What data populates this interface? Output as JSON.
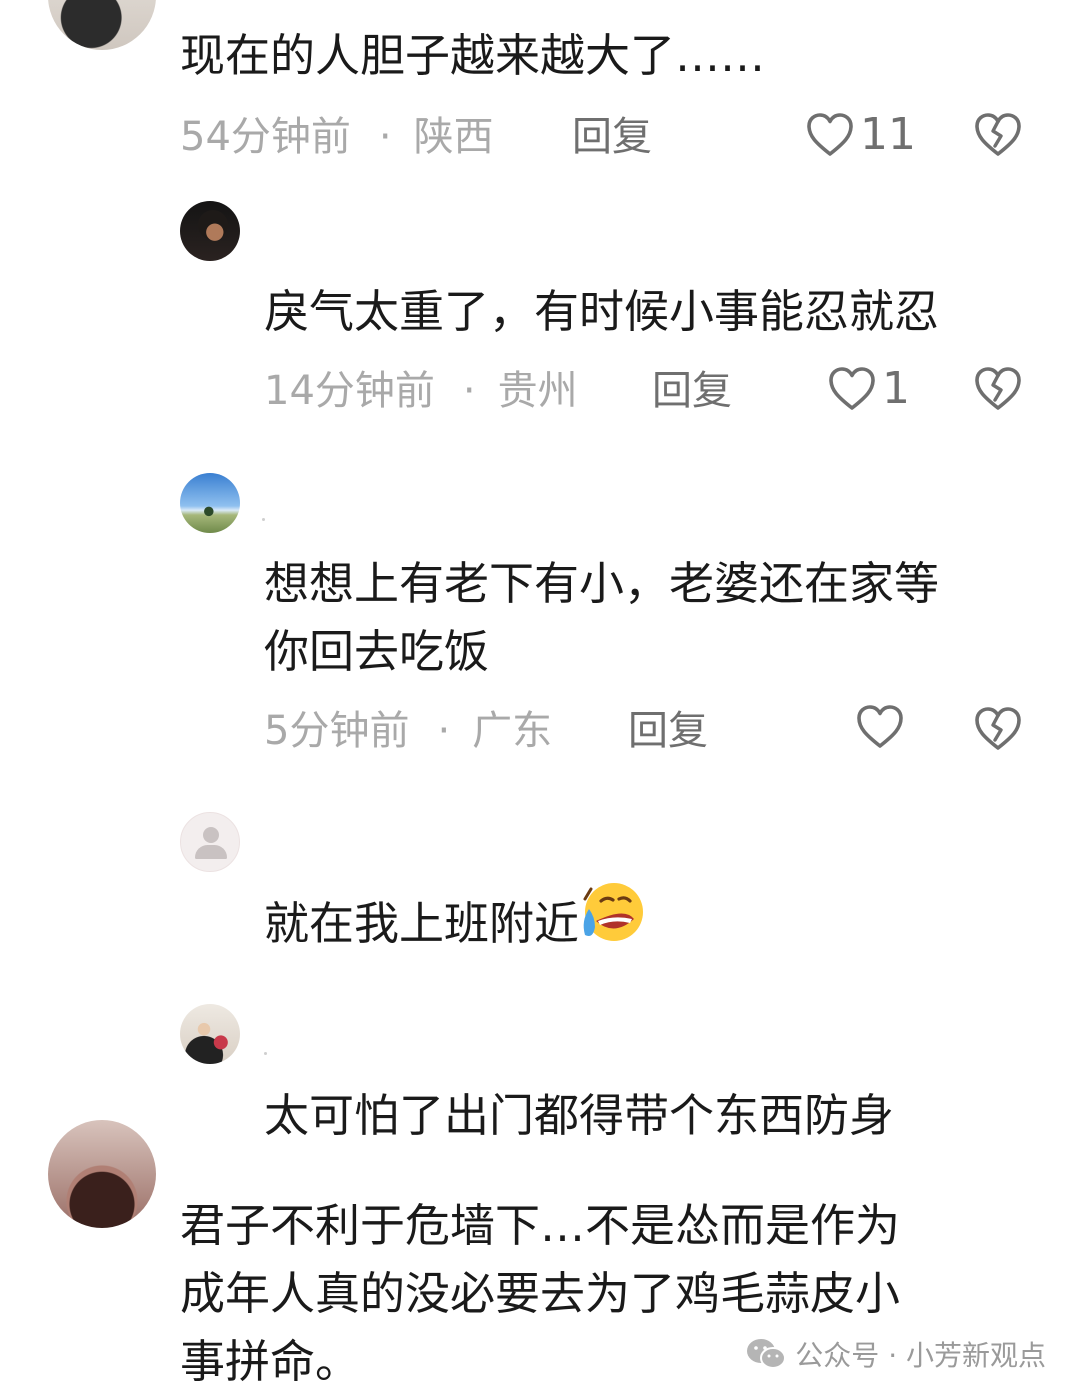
{
  "comments": [
    {
      "text": "现在的人胆子越来越大了……",
      "time": "54分钟前",
      "location": "陕西",
      "reply_label": "回复",
      "likes": "11"
    },
    {
      "text": "戾气太重了，有时候小事能忍就忍",
      "time": "14分钟前",
      "location": "贵州",
      "reply_label": "回复",
      "likes": "1"
    },
    {
      "text_line1": "想想上有老下有小，老婆还在家等",
      "text_line2": "你回去吃饭",
      "time": "5分钟前",
      "location": "广东",
      "reply_label": "回复"
    },
    {
      "text": "就在我上班附近"
    },
    {
      "text": "太可怕了出门都得带个东西防身"
    },
    {
      "text_line1": "君子不利于危墙下…不是怂而是作为",
      "text_line2": "成年人真的没必要去为了鸡毛蒜皮小",
      "text_line3": "事拼命。"
    }
  ],
  "meta_separator": "·",
  "watermark": "公众号 · 小芳新观点",
  "colors": {
    "text": "#1a1a1a",
    "meta": "#a9a9a9",
    "action": "#6f6f6f"
  }
}
